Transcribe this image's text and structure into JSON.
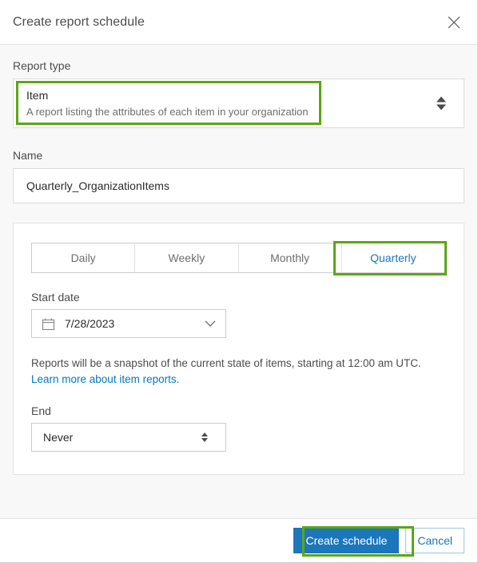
{
  "dialog": {
    "title": "Create report schedule",
    "close_icon": "close-icon"
  },
  "report_type": {
    "label": "Report type",
    "selected_title": "Item",
    "selected_description": "A report listing the attributes of each item in your organization",
    "stepper_icon": "up-down-stepper-icon",
    "highlight_color": "#5ba617"
  },
  "name": {
    "label": "Name",
    "value": "Quarterly_OrganizationItems",
    "placeholder": "Name"
  },
  "schedule": {
    "tabs": [
      {
        "label": "Daily",
        "active": false
      },
      {
        "label": "Weekly",
        "active": false
      },
      {
        "label": "Monthly",
        "active": false
      },
      {
        "label": "Quarterly",
        "active": true
      }
    ],
    "start_date": {
      "label": "Start date",
      "value": "7/28/2023",
      "calendar_icon": "calendar-icon",
      "chevron_icon": "chevron-down-icon"
    },
    "note_text": "Reports will be a snapshot of the current state of items, starting at 12:00 am UTC.",
    "note_link": "Learn more about item reports.",
    "end": {
      "label": "End",
      "value": "Never",
      "options": [
        "Never"
      ],
      "stepper_icon": "up-down-stepper-icon"
    }
  },
  "footer": {
    "primary_label": "Create schedule",
    "secondary_label": "Cancel"
  },
  "colors": {
    "accent_blue": "#1c76bb",
    "link_blue": "#0079c1",
    "highlight_green": "#5ba617"
  }
}
